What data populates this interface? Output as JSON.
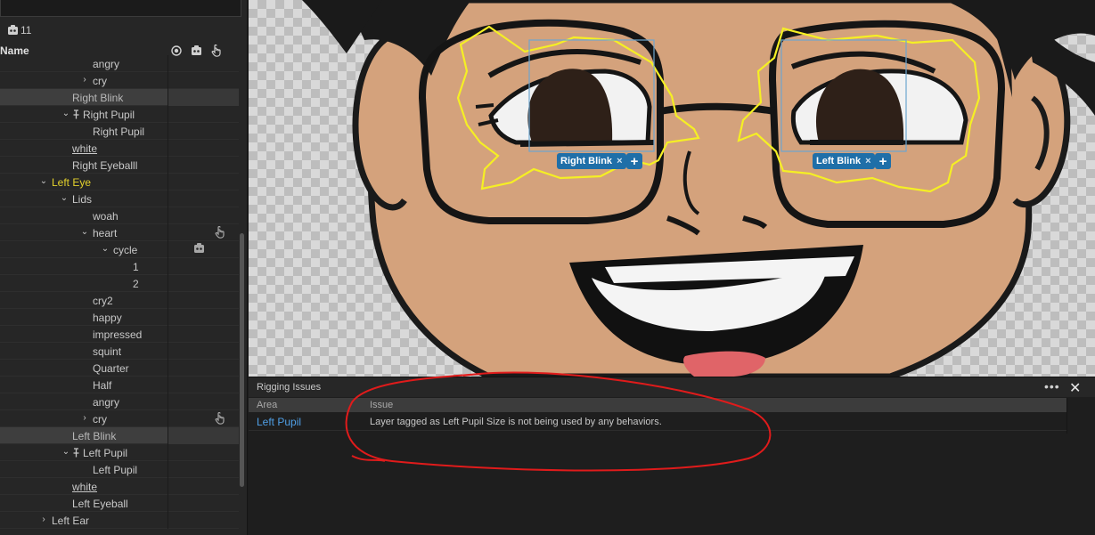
{
  "layers_panel": {
    "count": "11",
    "header_label": "Name",
    "rows": [
      {
        "label": "angry",
        "indent": 104,
        "twirl": "",
        "style": ""
      },
      {
        "label": "cry",
        "indent": 104,
        "twirl": "›",
        "style": ""
      },
      {
        "label": "Right Blink",
        "indent": 81,
        "twirl": "",
        "style": "dim",
        "selected": true
      },
      {
        "label": "Right Pupil",
        "indent": 93,
        "twirl": "⌄",
        "style": "",
        "pin": true
      },
      {
        "label": "Right Pupil",
        "indent": 104,
        "twirl": "",
        "style": ""
      },
      {
        "label": "white",
        "indent": 81,
        "twirl": "",
        "style": "under"
      },
      {
        "label": "Right Eyeballl",
        "indent": 81,
        "twirl": "",
        "style": ""
      },
      {
        "label": "Left Eye",
        "indent": 58,
        "twirl": "⌄",
        "style": "yellow"
      },
      {
        "label": "Lids",
        "indent": 81,
        "twirl": "⌄",
        "style": ""
      },
      {
        "label": "woah",
        "indent": 104,
        "twirl": "",
        "style": ""
      },
      {
        "label": "heart",
        "indent": 104,
        "twirl": "⌄",
        "style": "",
        "icon": "hand"
      },
      {
        "label": "cycle",
        "indent": 127,
        "twirl": "⌄",
        "style": "",
        "icon": "cycle"
      },
      {
        "label": "1",
        "indent": 149,
        "twirl": "",
        "style": ""
      },
      {
        "label": "2",
        "indent": 149,
        "twirl": "",
        "style": ""
      },
      {
        "label": "cry2",
        "indent": 104,
        "twirl": "",
        "style": ""
      },
      {
        "label": "happy",
        "indent": 104,
        "twirl": "",
        "style": ""
      },
      {
        "label": "impressed",
        "indent": 104,
        "twirl": "",
        "style": ""
      },
      {
        "label": "squint",
        "indent": 104,
        "twirl": "",
        "style": ""
      },
      {
        "label": "Quarter",
        "indent": 104,
        "twirl": "",
        "style": ""
      },
      {
        "label": "Half",
        "indent": 104,
        "twirl": "",
        "style": ""
      },
      {
        "label": "angry",
        "indent": 104,
        "twirl": "",
        "style": ""
      },
      {
        "label": "cry",
        "indent": 104,
        "twirl": "›",
        "style": "",
        "icon": "hand"
      },
      {
        "label": "Left Blink",
        "indent": 81,
        "twirl": "",
        "style": "dim",
        "selected": true
      },
      {
        "label": "Left Pupil",
        "indent": 93,
        "twirl": "⌄",
        "style": "",
        "pin": true
      },
      {
        "label": "Left Pupil",
        "indent": 104,
        "twirl": "",
        "style": ""
      },
      {
        "label": "white",
        "indent": 81,
        "twirl": "",
        "style": "under"
      },
      {
        "label": "Left Eyeball",
        "indent": 81,
        "twirl": "",
        "style": ""
      },
      {
        "label": "Left Ear",
        "indent": 58,
        "twirl": "›",
        "style": ""
      }
    ]
  },
  "canvas": {
    "tags": [
      {
        "label": "Right Blink",
        "close": "×"
      },
      {
        "label": "Left Blink",
        "close": "×"
      }
    ],
    "add_symbol": "+"
  },
  "rigging_issues": {
    "title": "Rigging Issues",
    "more": "•••",
    "close": "✕",
    "columns": {
      "area": "Area",
      "issue": "Issue"
    },
    "rows": [
      {
        "area": "Left Pupil",
        "issue": "Layer tagged as Left Pupil Size is not being used by any behaviors."
      }
    ]
  },
  "colors": {
    "accent_blue": "#1f6fa8",
    "link_blue": "#4f9fe6",
    "selected_group_yellow": "#e3d12c",
    "annotation_red": "#e01b1b",
    "mesh_yellow": "#f5ef24"
  }
}
